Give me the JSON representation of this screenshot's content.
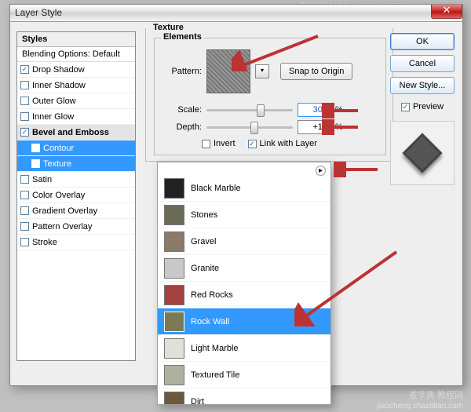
{
  "window": {
    "title": "Layer Style"
  },
  "sidebar": {
    "head": "Styles",
    "sub": "Blending Options: Default",
    "items": [
      {
        "label": "Drop Shadow",
        "checked": true,
        "sub": false
      },
      {
        "label": "Inner Shadow",
        "checked": false,
        "sub": false
      },
      {
        "label": "Outer Glow",
        "checked": false,
        "sub": false
      },
      {
        "label": "Inner Glow",
        "checked": false,
        "sub": false
      },
      {
        "label": "Bevel and Emboss",
        "checked": true,
        "sub": false,
        "be": true
      },
      {
        "label": "Contour",
        "checked": true,
        "sub": true,
        "sel": true
      },
      {
        "label": "Texture",
        "checked": true,
        "sub": true,
        "sel": true
      },
      {
        "label": "Satin",
        "checked": false,
        "sub": false
      },
      {
        "label": "Color Overlay",
        "checked": false,
        "sub": false
      },
      {
        "label": "Gradient Overlay",
        "checked": false,
        "sub": false
      },
      {
        "label": "Pattern Overlay",
        "checked": false,
        "sub": false
      },
      {
        "label": "Stroke",
        "checked": false,
        "sub": false
      }
    ]
  },
  "main": {
    "title": "Texture",
    "elements_title": "Elements",
    "pattern_label": "Pattern:",
    "snap_label": "Snap to Origin",
    "scale_label": "Scale:",
    "scale_value": "300",
    "scale_unit": "%",
    "depth_label": "Depth:",
    "depth_value": "+10",
    "depth_unit": "%",
    "invert_label": "Invert",
    "link_label": "Link with Layer"
  },
  "buttons": {
    "ok": "OK",
    "cancel": "Cancel",
    "new_style": "New Style...",
    "preview": "Preview"
  },
  "patterns": [
    {
      "name": "Black Marble",
      "color": "#222"
    },
    {
      "name": "Stones",
      "color": "#6a6a55"
    },
    {
      "name": "Gravel",
      "color": "#8a7a6a"
    },
    {
      "name": "Granite",
      "color": "#c8c8c8"
    },
    {
      "name": "Red Rocks",
      "color": "#a54040"
    },
    {
      "name": "Rock Wall",
      "color": "#7a7a55",
      "selected": true
    },
    {
      "name": "Light Marble",
      "color": "#e0e0d8"
    },
    {
      "name": "Textured Tile",
      "color": "#b0b0a0"
    },
    {
      "name": "Dirt",
      "color": "#6a5a3a"
    }
  ],
  "watermarks": {
    "top": "思缘设计论坛  WWW.MISSYUAN.COM",
    "bottom_main": "查字典 教程网",
    "bottom_sub": "jiaocheng.chazidian.com"
  }
}
